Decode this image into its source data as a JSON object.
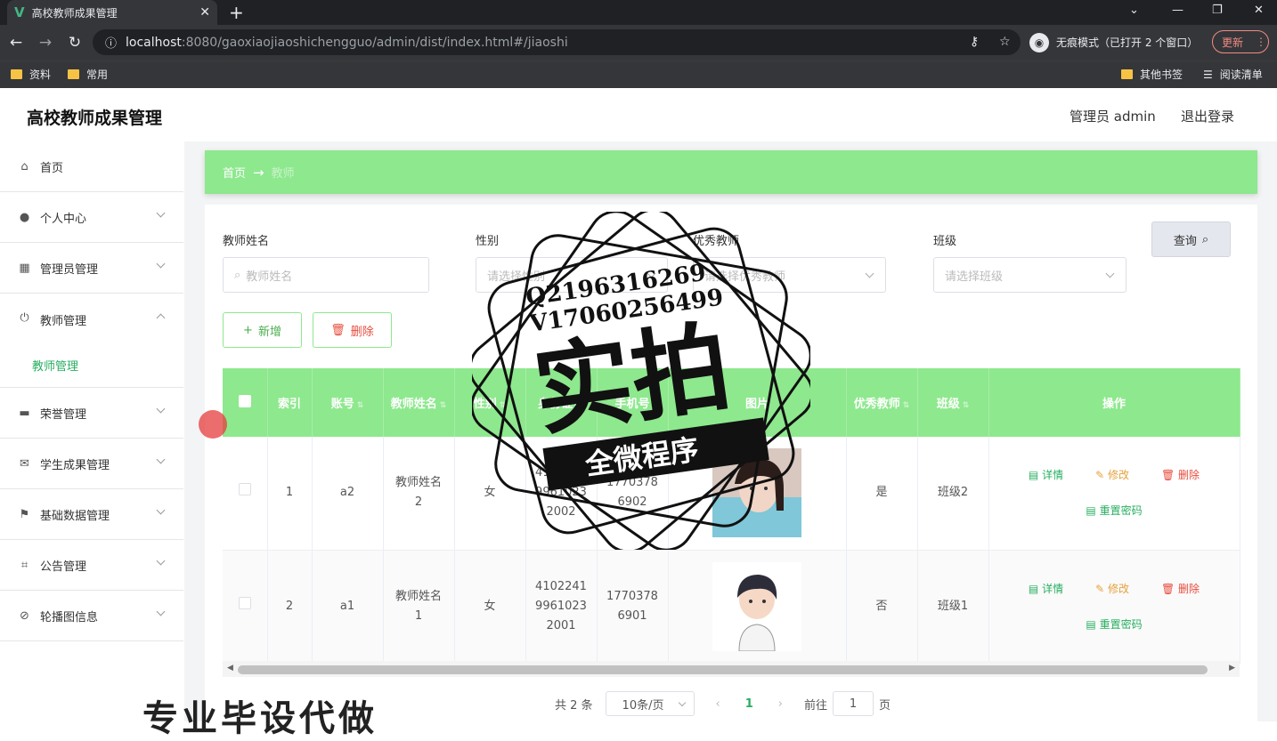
{
  "browser": {
    "tab_title": "高校教师成果管理",
    "url_host": "localhost",
    "url_path": ":8080/gaoxiaojiaoshichengguo/admin/dist/index.html#/jiaoshi",
    "incognito_label": "无痕模式（已打开 2 个窗口）",
    "update_label": "更新",
    "bookmarks": [
      "资料",
      "常用"
    ],
    "other_bookmarks": "其他书签",
    "reading_list": "阅读清单"
  },
  "header": {
    "brand": "高校教师成果管理",
    "admin": "管理员 admin",
    "logout": "退出登录"
  },
  "sidebar": {
    "items": [
      "首页",
      "个人中心",
      "管理员管理",
      "教师管理",
      "荣誉管理",
      "学生成果管理",
      "基础数据管理",
      "公告管理",
      "轮播图信息"
    ],
    "sub_item": "教师管理"
  },
  "breadcrumb": {
    "home": "首页",
    "current": "教师"
  },
  "filters": {
    "name_label": "教师姓名",
    "name_placeholder": "教师姓名",
    "sex_label": "性别",
    "sex_placeholder": "请选择性别",
    "excellent_label": "优秀教师",
    "excellent_placeholder": "请选择优秀教师",
    "class_label": "班级",
    "class_placeholder": "请选择班级",
    "query_button": "查询"
  },
  "actions": {
    "add": "新增",
    "delete": "删除"
  },
  "table": {
    "headers": [
      "索引",
      "账号",
      "教师姓名",
      "性别",
      "身份证号",
      "手机号",
      "图片",
      "优秀教师",
      "班级",
      "操作"
    ],
    "rows": [
      {
        "index": "1",
        "account": "a2",
        "name": "教师姓名2",
        "sex": "女",
        "idcard": "410224199610232002",
        "phone": "17703786902",
        "excellent": "是",
        "class": "班级2"
      },
      {
        "index": "2",
        "account": "a1",
        "name": "教师姓名1",
        "sex": "女",
        "idcard": "410224199610232001",
        "phone": "17703786901",
        "excellent": "否",
        "class": "班级1"
      }
    ],
    "ops": {
      "detail": "详情",
      "edit": "修改",
      "remove": "删除",
      "reset": "重置密码"
    }
  },
  "pagination": {
    "total": "共 2 条",
    "page_size": "10条/页",
    "current": "1",
    "goto_prefix": "前往",
    "goto_value": "1",
    "goto_suffix": "页"
  },
  "watermark": {
    "line1": "Q2196316269",
    "line2": "V17060256499",
    "big": "实拍",
    "ribbon": "全微程序",
    "banner": "专业毕设代做"
  }
}
